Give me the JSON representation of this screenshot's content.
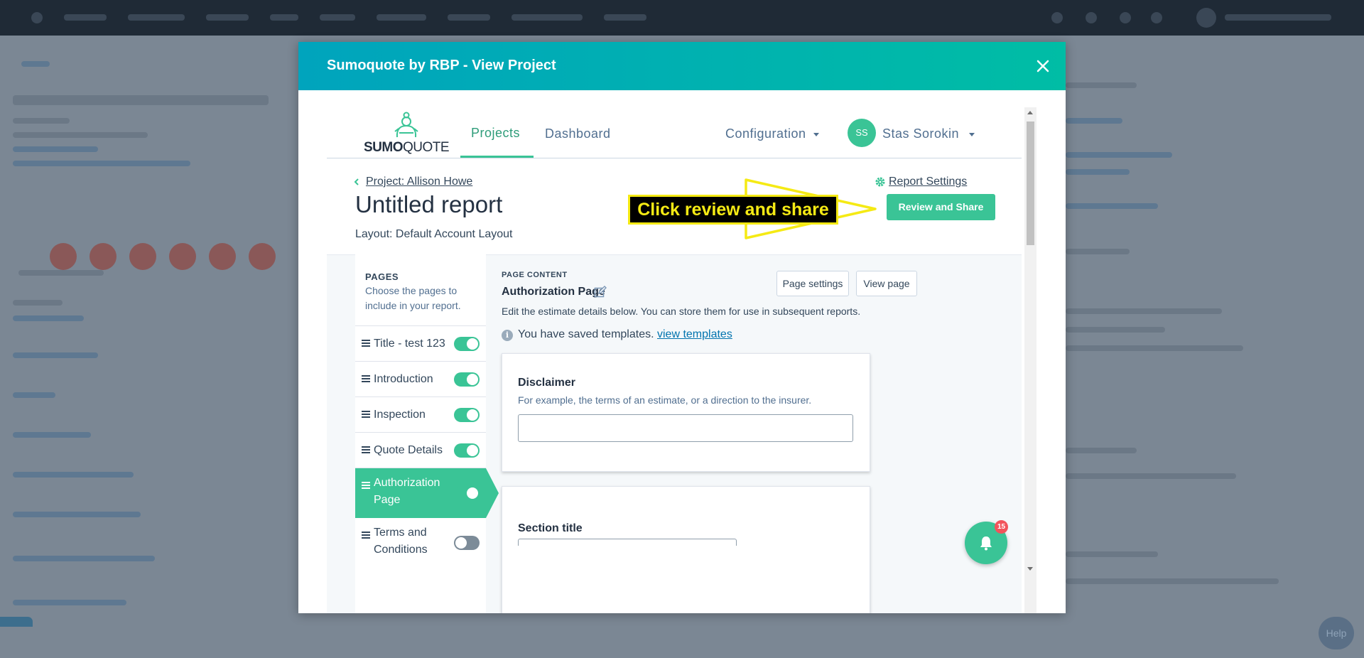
{
  "modal": {
    "title": "Sumoquote by RBP - View Project"
  },
  "app_nav": {
    "logo_sumo": "SUMO",
    "logo_quote": "QUOTE",
    "tabs": [
      {
        "label": "Projects",
        "active": true
      },
      {
        "label": "Dashboard",
        "active": false
      }
    ],
    "configuration_label": "Configuration",
    "user_initials": "SS",
    "user_name": "Stas Sorokin"
  },
  "report": {
    "back_link": "Project: Allison Howe",
    "title": "Untitled report",
    "layout_line": "Layout: Default Account Layout",
    "settings_link": "Report Settings",
    "review_button": "Review and Share"
  },
  "annotation": {
    "callout_text": "Click review and share",
    "color": "#f5ea14"
  },
  "pages_panel": {
    "title": "PAGES",
    "description": "Choose the pages to include in your report.",
    "items": [
      {
        "label": "Title - test 123",
        "enabled": true,
        "active": false
      },
      {
        "label": "Introduction",
        "enabled": true,
        "active": false
      },
      {
        "label": "Inspection",
        "enabled": true,
        "active": false
      },
      {
        "label": "Quote Details",
        "enabled": true,
        "active": false
      },
      {
        "label": "Authorization Page",
        "enabled": true,
        "active": true
      },
      {
        "label": "Terms and Conditions",
        "enabled": false,
        "active": false
      }
    ]
  },
  "content": {
    "section_label": "PAGE CONTENT",
    "page_title": "Authorization Page",
    "description": "Edit the estimate details below. You can store them for use in subsequent reports.",
    "page_settings_button": "Page settings",
    "view_page_button": "View page",
    "templates_text": "You have saved templates.",
    "templates_link": "view templates",
    "disclaimer": {
      "title": "Disclaimer",
      "description": "For example, the terms of an estimate, or a direction to the insurer.",
      "value": ""
    },
    "section_title_label": "Section title"
  },
  "notifications": {
    "count": "15"
  },
  "background": {
    "help_label": "Help"
  },
  "colors": {
    "accent": "#3ac496",
    "header_start": "#00a4bd",
    "header_end": "#00bda5",
    "badge": "#f2545b"
  }
}
